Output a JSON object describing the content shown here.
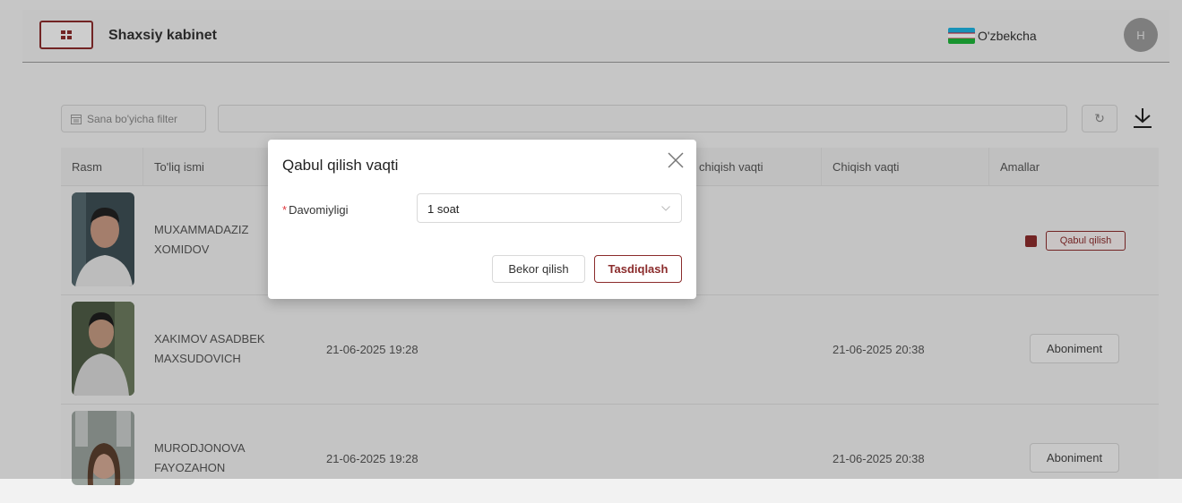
{
  "header": {
    "title": "Shaxsiy kabinet",
    "language": "O'zbekcha",
    "avatar_initial": "H"
  },
  "toolbar": {
    "date_filter_label": "Sana bo'yicha filter",
    "search_value": ""
  },
  "table": {
    "columns": [
      "Rasm",
      "To'liq ismi",
      "",
      "",
      "chiqish vaqti",
      "Chiqish vaqti",
      "Amallar"
    ],
    "rows": [
      {
        "name_line1": "MUXAMMADAZIZ",
        "name_line2": "XOMIDOV",
        "entry_time": "",
        "exit_time": "",
        "action_label": "Qabul qilish"
      },
      {
        "name_line1": "XAKIMOV ASADBEK",
        "name_line2": "MAXSUDOVICH",
        "entry_time": "21-06-2025 19:28",
        "exit_time": "21-06-2025 20:38",
        "action_label": "Aboniment"
      },
      {
        "name_line1": "MURODJONOVA",
        "name_line2": "FAYOZAHON",
        "entry_time": "21-06-2025 19:28",
        "exit_time": "21-06-2025 20:38",
        "action_label": "Aboniment"
      }
    ]
  },
  "modal": {
    "title": "Qabul qilish vaqti",
    "field_label": "Davomiyligi",
    "field_required_mark": "*",
    "field_value": "1 soat",
    "cancel_label": "Bekor qilish",
    "confirm_label": "Tasdiqlash"
  },
  "colors": {
    "accent": "#8b2c2c",
    "background": "#f2f2f2"
  }
}
